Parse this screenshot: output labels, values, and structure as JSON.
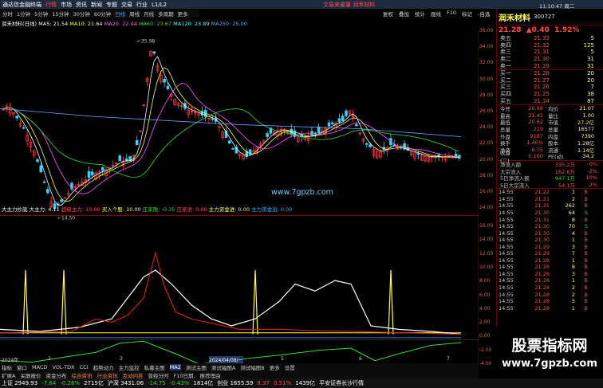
{
  "window": {
    "title_items": [
      "通达信金融终端",
      "行情",
      "市场",
      "资讯",
      "新闻",
      "专题",
      "交易",
      "行业",
      "L1/L2"
    ],
    "brand": "文易来量量 润禾材料",
    "clock": "11:10:47 周二"
  },
  "timeframes": [
    "分时",
    "1分钟",
    "5分钟",
    "15分钟",
    "30分钟",
    "60分钟",
    "日线",
    "周线",
    "月线",
    "多周期",
    "更多"
  ],
  "selected_timeframe": "日线",
  "toolbar_right": [
    "复权",
    "叠加",
    "统计",
    "画线",
    "F10",
    "标记",
    "-自选",
    "返回"
  ],
  "ma_line": {
    "label": "润禾材料(日线)",
    "ma5": "MA5: 21.54",
    "ma10": "MA10: 21.64",
    "ma20": "MA20: 22.44",
    "ma60": "MA60: 23.67",
    "ma120": "MA120: 23.89",
    "ma250": "MA250: 25.00"
  },
  "sub_line": {
    "name": "大主力抄底",
    "v1": "大主力: 4.11",
    "v2": "超级主力: 10.00",
    "v3": "买入个股: 10.00",
    "v4": "庄家散: -0.35",
    "v5": "庄家进: 0.00",
    "v6": "主力资金进: 0.00",
    "v7": "主力资金出: 0.00"
  },
  "watermark": "www.7gpzb.com",
  "price_high": "35.98",
  "price_low": "14.50",
  "dates": [
    "2024年",
    "2",
    "3",
    "4",
    "5",
    "6",
    "7"
  ],
  "date_highlight": "2024/04/08/一",
  "bottom_tabs": [
    "指标",
    "窗口",
    "MACD",
    "VOL-TDX",
    "CCI",
    "趋势动力",
    "主力监控",
    "私募主图",
    "MA2",
    "测试主图",
    "测试幅图A",
    "测试幅图B",
    "更多",
    "设置"
  ],
  "bottom_tabs2": [
    "扩展A",
    "关联报价",
    "资金分布",
    "综合资讯",
    "行业资讯",
    "互动问答",
    "曾经分时",
    "F10日期,",
    "推荐理由"
  ],
  "status": {
    "sh": "上证 2949.93",
    "sh_ch": "-7.64",
    "sh_pct": "-0.26%",
    "sh_vol": "2715亿",
    "sz": "沪深 3431.06",
    "sz_ch": "-14.75",
    "sz_pct": "-0.43%",
    "sz_vol": "1814亿",
    "cy": "创业 1655.59",
    "cy_ch": "8.37",
    "cy_pct": "0.51%",
    "cy_vol": "1439亿",
    "msg": "平安证券长沙行情"
  },
  "y_axis_main": [
    "36.00",
    "34.00",
    "32.00",
    "30.00",
    "28.00",
    "26.00",
    "24.00",
    "22.00",
    "20.00",
    "18.00",
    "16.00",
    "14.00"
  ],
  "y_axis_sub": [
    "16.00",
    "14.00",
    "12.00",
    "10.00",
    "8.00",
    "6.00",
    "4.00",
    "2.00",
    "0.00",
    "-2.00",
    "-4.00"
  ],
  "quote": {
    "name": "润禾材料",
    "code": "300727",
    "price": "21.28",
    "change": "▲0.40",
    "pct": "1.92%",
    "sell": [
      {
        "l": "卖五",
        "p": "21.33",
        "v": "5"
      },
      {
        "l": "卖四",
        "p": "21.32",
        "v": "125"
      },
      {
        "l": "卖三",
        "p": "21.31",
        "v": "5"
      },
      {
        "l": "卖二",
        "p": "21.30",
        "v": "31"
      },
      {
        "l": "卖一",
        "p": "21.29",
        "v": "31"
      }
    ],
    "buy": [
      {
        "l": "买一",
        "p": "21.28",
        "v": "20"
      },
      {
        "l": "买二",
        "p": "21.27",
        "v": "20"
      },
      {
        "l": "买三",
        "p": "21.26",
        "v": "7"
      },
      {
        "l": "买四",
        "p": "21.25",
        "v": "38"
      },
      {
        "l": "买五",
        "p": "21.24",
        "v": "87"
      }
    ],
    "stats": [
      [
        "今开",
        "20.88",
        "均价",
        "21.07"
      ],
      [
        "最高",
        "21.41",
        "量比",
        "1.00"
      ],
      [
        "最低",
        "20.62",
        "市值",
        "27.2亿"
      ],
      [
        "总量",
        "219",
        "总量",
        "16577"
      ],
      [
        "外盘",
        "9187",
        "内盘",
        "7390"
      ],
      [
        "换手",
        "1.46%",
        "股本",
        "1.28亿"
      ],
      [
        "净资",
        "6.75",
        "流通",
        "1.14亿"
      ],
      [
        "收益(二)",
        "0.160",
        "PE(动)",
        "34.2"
      ]
    ],
    "flows": [
      [
        "净流入额",
        "335.2万",
        "0%"
      ],
      [
        "大宗流入",
        "162.6万",
        "-2%"
      ],
      [
        "5日净流入额",
        "-947.1万",
        "10%"
      ],
      [
        "5日大宗流入",
        "54.1万",
        "2%"
      ]
    ],
    "ticks": [
      [
        "14:55",
        "21.22",
        "1",
        "B"
      ],
      [
        "14:55",
        "21.21",
        "2",
        "B"
      ],
      [
        "14:55",
        "21.31",
        "262",
        "B"
      ],
      [
        "14:55",
        "21.30",
        "64",
        "S"
      ],
      [
        "14:55",
        "21.31",
        "8",
        "B"
      ],
      [
        "14:55",
        "21.30",
        "70",
        "S"
      ],
      [
        "14:55",
        "21.30",
        "4",
        "B"
      ],
      [
        "14:55",
        "21.30",
        "1",
        "B"
      ],
      [
        "14:55",
        "21.29",
        "3",
        "B"
      ],
      [
        "14:55",
        "21.29",
        "7",
        "B"
      ],
      [
        "14:55",
        "21.28",
        "1",
        "B"
      ],
      [
        "14:55",
        "21.28",
        "8",
        "B"
      ],
      [
        "14:55",
        "21.28",
        "3",
        "B"
      ],
      [
        "14:55",
        "21.28",
        "1",
        "B"
      ],
      [
        "14:55",
        "21.28",
        "2",
        "B"
      ],
      [
        "14:55",
        "21.28",
        "2",
        "B"
      ],
      [
        "14:55",
        "21.28",
        "5",
        "B"
      ],
      [
        "14:55",
        "21.28",
        "1",
        "B"
      ]
    ]
  },
  "promo": {
    "title": "股票指标网",
    "url": "www.7gpzb.com"
  }
}
